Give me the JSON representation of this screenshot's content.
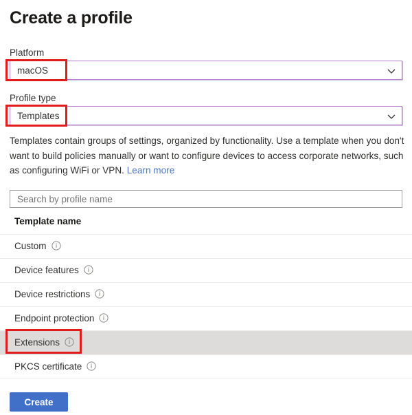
{
  "header": {
    "title": "Create a profile"
  },
  "form": {
    "platform": {
      "label": "Platform",
      "value": "macOS",
      "chevron_icon": "chevron-down-icon"
    },
    "profile_type": {
      "label": "Profile type",
      "value": "Templates",
      "chevron_icon": "chevron-down-icon"
    },
    "description": {
      "text": "Templates contain groups of settings, organized by functionality. Use a template when you don't want to build policies manually or want to configure devices to access corporate networks, such as configuring WiFi or VPN. ",
      "link_label": "Learn more",
      "link_color": "#4f76c1"
    }
  },
  "search": {
    "placeholder": "Search by profile name",
    "value": ""
  },
  "table": {
    "column_header": "Template name",
    "rows": [
      {
        "label": "Custom",
        "info_icon": "info-circle-icon",
        "hovered": false
      },
      {
        "label": "Device features",
        "info_icon": "info-circle-icon",
        "hovered": false
      },
      {
        "label": "Device restrictions",
        "info_icon": "info-circle-icon",
        "hovered": false
      },
      {
        "label": "Endpoint protection",
        "info_icon": "info-circle-icon",
        "hovered": false
      },
      {
        "label": "Extensions",
        "info_icon": "info-circle-icon",
        "hovered": true
      },
      {
        "label": "PKCS certificate",
        "info_icon": "info-circle-icon",
        "hovered": false
      }
    ]
  },
  "footer": {
    "create_label": "Create",
    "create_color": "#4070c8"
  },
  "annotations": {
    "color": "#e01b1b",
    "targets": [
      "platform-dropdown",
      "profile-type-dropdown",
      "extensions-row"
    ]
  }
}
